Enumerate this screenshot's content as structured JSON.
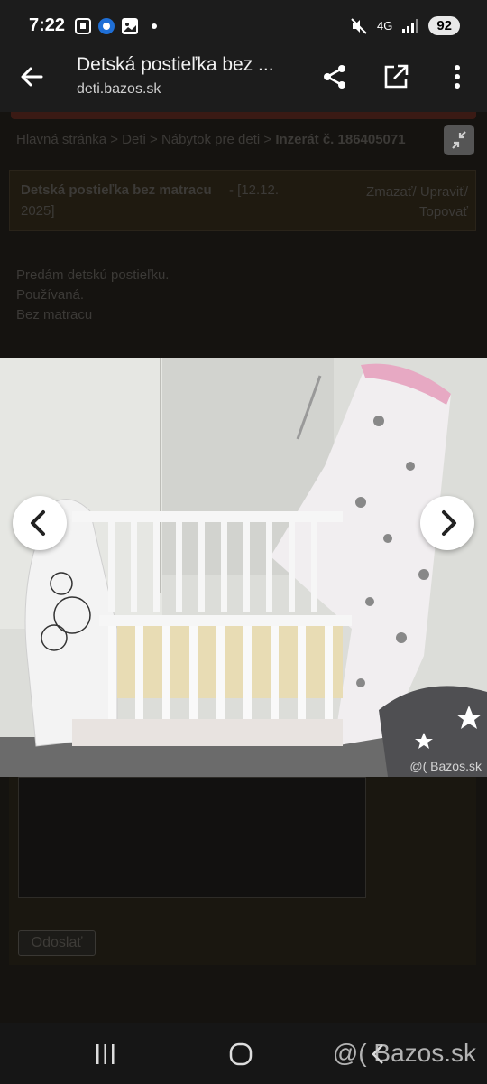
{
  "statusbar": {
    "time": "7:22",
    "network": "4G",
    "battery": "92"
  },
  "appbar": {
    "title": "Detská postieľka bez ...",
    "url": "deti.bazos.sk"
  },
  "breadcrumb": {
    "home": "Hlavná stránka",
    "sep": " > ",
    "cat1": "Deti",
    "cat2": "Nábytok pre deti",
    "current": "Inzerát č. 186405071"
  },
  "listing": {
    "title": "Detská postieľka bez matracu",
    "date_line1": "- [12.12.",
    "date_line2": "2025]",
    "actions_line1": "Zmazať/ Upraviť/",
    "actions_line2": "Topovať"
  },
  "description": [
    "Predám detskú postieľku.",
    "Používaná.",
    "Bez matracu"
  ],
  "photo": {
    "watermark": "@( Bazos.sk"
  },
  "form": {
    "send_label": "Odoslať"
  },
  "navbar": {
    "watermark": "@( Bazos.sk"
  }
}
